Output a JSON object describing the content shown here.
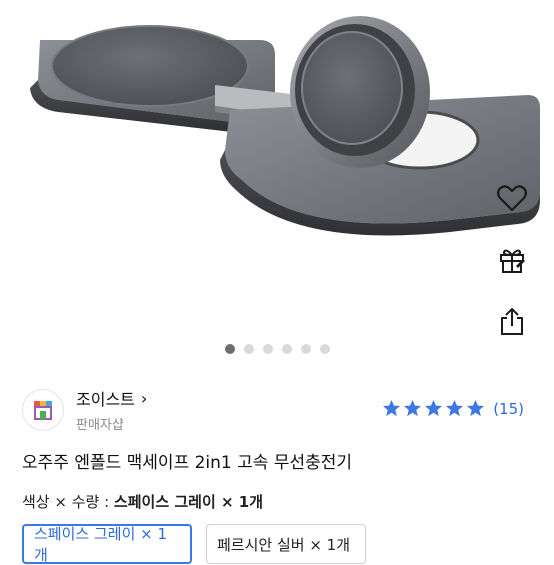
{
  "side_actions": {
    "wishlist": "heart-icon",
    "gift": "gift-icon",
    "share": "share-icon"
  },
  "gallery": {
    "active_index": 0,
    "dot_count": 6
  },
  "seller": {
    "name": "조이스트",
    "chevron": "›",
    "subtitle": "판매자샵"
  },
  "rating": {
    "stars": 5,
    "count": "(15)",
    "star_color": "#3f78e0"
  },
  "product": {
    "title": "오주주 엔폴드 맥세이프 2in1 고속 무선충전기"
  },
  "options": {
    "label_prefix": "색상 × 수량 :",
    "label_value": "스페이스 그레이 × 1개",
    "chips": [
      {
        "label": "스페이스 그레이 × 1개",
        "selected": true
      },
      {
        "label": "페르시안 실버 × 1개",
        "selected": false
      }
    ]
  },
  "colors": {
    "accent": "#3a79e6",
    "charger": "#5a5c61"
  }
}
